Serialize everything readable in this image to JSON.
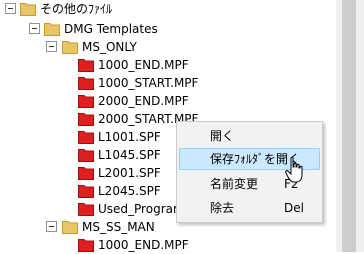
{
  "tree": {
    "other_folder": "その他のﾌｧｲﾙ",
    "dmg_templates": "DMG Templates",
    "ms_only": "MS_ONLY",
    "files": [
      "1000_END.MPF",
      "1000_START.MPF",
      "2000_END.MPF",
      "2000_START.MPF",
      "L1001.SPF",
      "L1045.SPF",
      "L2001.SPF",
      "L2045.SPF",
      "Used_Program"
    ],
    "ms_ss_man": "MS_SS_MAN",
    "file_last": "1000_END.MPF"
  },
  "context_menu": {
    "open": "開く",
    "open_folder": "保存ﾌｫﾙﾀﾞを開く",
    "rename": "名前変更",
    "rename_key": "F2",
    "delete": "除去",
    "delete_key": "Del"
  },
  "colors": {
    "folder": "#e8c566",
    "file_icon": "#e02020",
    "hover": "#cce8ff"
  }
}
